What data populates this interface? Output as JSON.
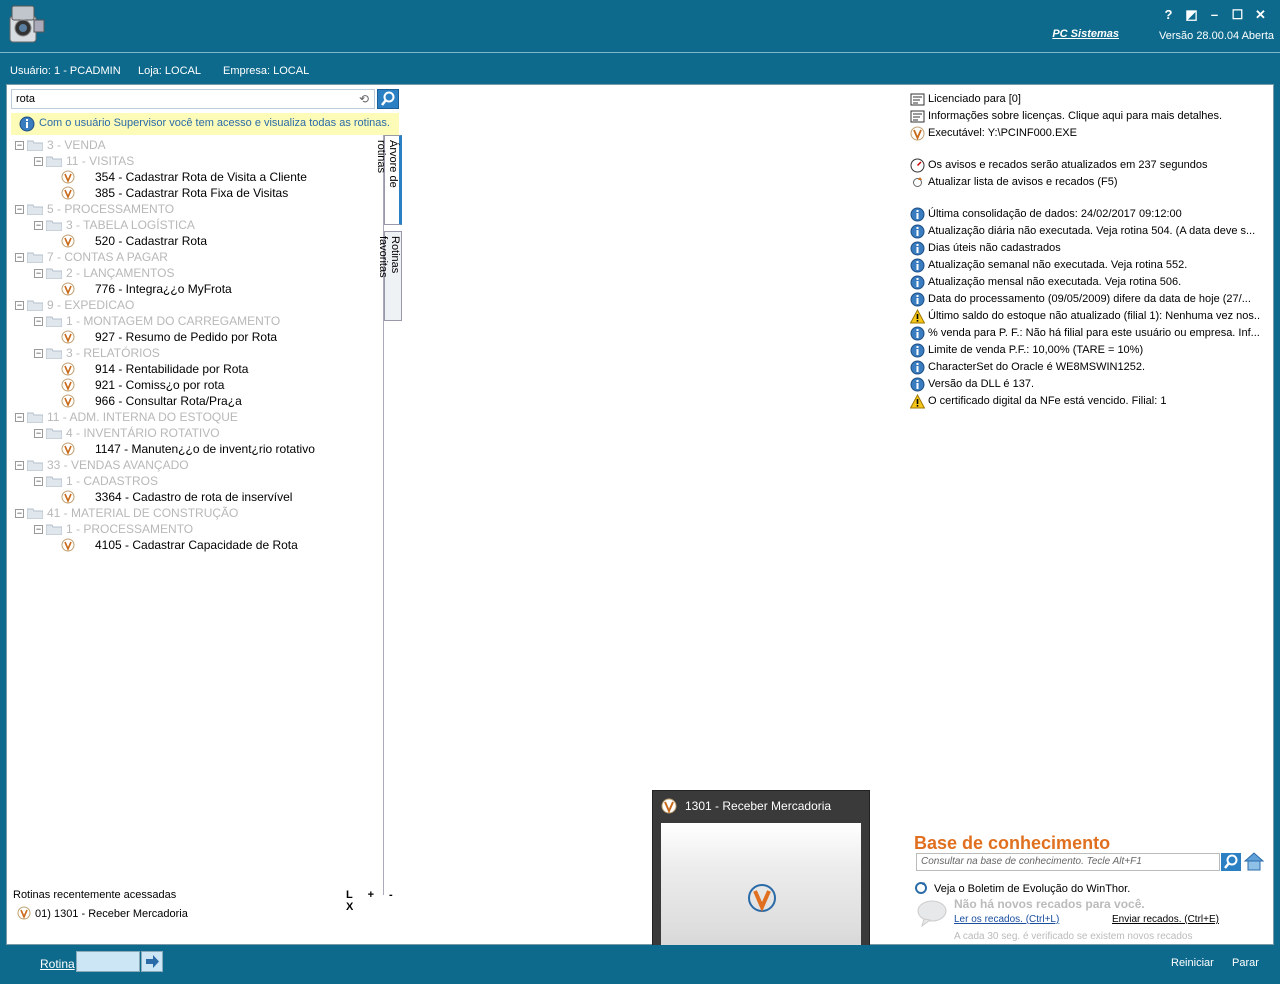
{
  "window": {
    "brand": "PC Sistemas",
    "version": "Versão 28.00.04 Aberta",
    "buttons": [
      "?",
      "◩",
      "–",
      "☐",
      "✕"
    ]
  },
  "userbar": {
    "usuario": "Usuário: 1 - PCADMIN",
    "loja": "Loja: LOCAL",
    "empresa": "Empresa: LOCAL"
  },
  "search": {
    "value": "rota"
  },
  "info_bar": "Com o usuário Supervisor você tem acesso e visualiza todas as rotinas.",
  "tabs": {
    "arvore": "Árvore de rotinas",
    "favoritas": "Rotinas favoritas"
  },
  "tree": [
    {
      "level": 0,
      "type": "folder",
      "label": "3 - VENDA"
    },
    {
      "level": 1,
      "type": "folder",
      "label": "11 - VISITAS"
    },
    {
      "level": 2,
      "type": "leaf",
      "label": "354 - Cadastrar Rota de Visita a Cliente"
    },
    {
      "level": 2,
      "type": "leaf",
      "label": "385 - Cadastrar Rota Fixa de Visitas"
    },
    {
      "level": 0,
      "type": "folder",
      "label": "5 - PROCESSAMENTO"
    },
    {
      "level": 1,
      "type": "folder",
      "label": "3 - TABELA LOGÍSTICA"
    },
    {
      "level": 2,
      "type": "leaf",
      "label": "520 - Cadastrar Rota"
    },
    {
      "level": 0,
      "type": "folder",
      "label": "7 - CONTAS A PAGAR"
    },
    {
      "level": 1,
      "type": "folder",
      "label": "2 - LANÇAMENTOS"
    },
    {
      "level": 2,
      "type": "leaf",
      "label": "776 - Integra¿¿o MyFrota"
    },
    {
      "level": 0,
      "type": "folder",
      "label": "9 - EXPEDICAO"
    },
    {
      "level": 1,
      "type": "folder",
      "label": "1 - MONTAGEM DO CARREGAMENTO"
    },
    {
      "level": 2,
      "type": "leaf",
      "label": "927 - Resumo de Pedido por Rota"
    },
    {
      "level": 1,
      "type": "folder",
      "label": "3 - RELATÓRIOS"
    },
    {
      "level": 2,
      "type": "leaf",
      "label": "914 - Rentabilidade por Rota"
    },
    {
      "level": 2,
      "type": "leaf",
      "label": "921 - Comiss¿o por rota"
    },
    {
      "level": 2,
      "type": "leaf",
      "label": "966 - Consultar Rota/Pra¿a"
    },
    {
      "level": 0,
      "type": "folder",
      "label": "11 - ADM. INTERNA DO ESTOQUE"
    },
    {
      "level": 1,
      "type": "folder",
      "label": "4 - INVENTÁRIO ROTATIVO"
    },
    {
      "level": 2,
      "type": "leaf",
      "label": "1147 - Manuten¿¿o de invent¿rio rotativo"
    },
    {
      "level": 0,
      "type": "folder",
      "label": "33 - VENDAS AVANÇADO"
    },
    {
      "level": 1,
      "type": "folder",
      "label": "1 - CADASTROS"
    },
    {
      "level": 2,
      "type": "leaf",
      "label": "3364 - Cadastro de rota de inservível"
    },
    {
      "level": 0,
      "type": "folder",
      "label": "41 - MATERIAL DE CONSTRUÇÃO"
    },
    {
      "level": 1,
      "type": "folder",
      "label": "1 - PROCESSAMENTO"
    },
    {
      "level": 2,
      "type": "leaf",
      "label": "4105 - Cadastrar Capacidade de Rota"
    }
  ],
  "recent": {
    "title": "Rotinas recentemente acessadas",
    "actions": "L + - X",
    "items": [
      "01)  1301 - Receber Mercadoria"
    ]
  },
  "notices": [
    {
      "icon": "license-icon",
      "text": "Licenciado para [0]",
      "gap": false
    },
    {
      "icon": "license-icon",
      "text": "Informações sobre licenças. Clique aqui para mais detalhes.",
      "gap": false
    },
    {
      "icon": "winthor-icon",
      "text": "Executável: Y:\\PCINF000.EXE",
      "gap": false
    },
    {
      "icon": "clock-icon",
      "text": "Os avisos e recados serão atualizados em 237 segundos",
      "gap": true
    },
    {
      "icon": "refresh-icon",
      "text": "Atualizar lista de avisos e recados (F5)",
      "gap": false
    },
    {
      "icon": "info-icon",
      "text": "Última consolidação de dados: 24/02/2017 09:12:00",
      "gap": true
    },
    {
      "icon": "info-icon",
      "text": "Atualização diária não executada. Veja rotina 504. (A data deve s...",
      "gap": false
    },
    {
      "icon": "info-icon",
      "text": "Dias úteis não cadastrados",
      "gap": false
    },
    {
      "icon": "info-icon",
      "text": "Atualização semanal não executada. Veja rotina 552.",
      "gap": false
    },
    {
      "icon": "info-icon",
      "text": "Atualização mensal não executada. Veja rotina 506.",
      "gap": false
    },
    {
      "icon": "info-icon",
      "text": "Data do processamento (09/05/2009) difere da data de hoje (27/...",
      "gap": false
    },
    {
      "icon": "warning-icon",
      "text": "Último saldo do estoque não atualizado (filial 1): Nenhuma vez nos...",
      "gap": false
    },
    {
      "icon": "info-icon",
      "text": "% venda para P. F.: Não há filial para este usuário ou empresa. Inf...",
      "gap": false
    },
    {
      "icon": "info-icon",
      "text": "Limite de venda P.F.: 10,00% (TARE = 10%)",
      "gap": false
    },
    {
      "icon": "info-icon",
      "text": "CharacterSet do Oracle é WE8MSWIN1252.",
      "gap": false
    },
    {
      "icon": "info-icon",
      "text": "Versão da DLL é 137.",
      "gap": false
    },
    {
      "icon": "warning-icon",
      "text": "O certificado digital da NFe está vencido. Filial: 1",
      "gap": false
    }
  ],
  "kb": {
    "title": "Base de conhecimento",
    "placeholder": "Consultar na base de conhecimento. Tecle Alt+F1",
    "boletim": "Veja o Boletim de Evolução do WinThor.",
    "no_recados": "Não há novos recados para você.",
    "ler": "Ler os recados. (Ctrl+L)",
    "enviar": "Enviar recados. (Ctrl+E)",
    "footer": "A cada 30 seg. é verificado se existem novos recados"
  },
  "popup": {
    "title": "1301 - Receber Mercadoria"
  },
  "bottom": {
    "rotina": "Rotina",
    "reiniciar": "Reiniciar",
    "parar": "Parar"
  }
}
